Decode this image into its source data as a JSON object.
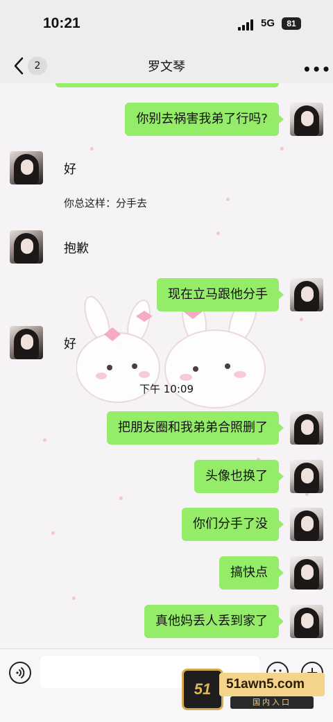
{
  "status": {
    "time": "10:21",
    "network": "5G",
    "battery": "81"
  },
  "header": {
    "title": "罗文琴",
    "unread_count": "2",
    "more_label": "•••"
  },
  "messages": [
    {
      "side": "self",
      "text": "你别去祸害我弟了行吗?"
    },
    {
      "side": "other",
      "text": "好",
      "note": "你总这样：分手去"
    },
    {
      "side": "other",
      "text": "抱歉"
    },
    {
      "side": "self",
      "text": "现在立马跟他分手"
    },
    {
      "side": "other",
      "text": "好"
    },
    {
      "side": "self",
      "text": "把朋友圈和我弟弟合照删了"
    },
    {
      "side": "self",
      "text": "头像也换了"
    },
    {
      "side": "self",
      "text": "你们分手了没"
    },
    {
      "side": "self",
      "text": "搞快点"
    },
    {
      "side": "self",
      "text": "真他妈丢人丢到家了"
    }
  ],
  "timestamp": "下午 10:09",
  "input": {
    "placeholder": ""
  },
  "watermark": {
    "badge": "51",
    "site": "51awn5.com",
    "sub": "国内入口"
  },
  "colors": {
    "self_bubble": "#95ec69",
    "background": "#f6f3f6",
    "bar": "#ededed"
  },
  "icons": {
    "back": "chevron-left-icon",
    "voice": "voice-icon",
    "emoji": "emoji-icon",
    "plus": "plus-icon"
  }
}
